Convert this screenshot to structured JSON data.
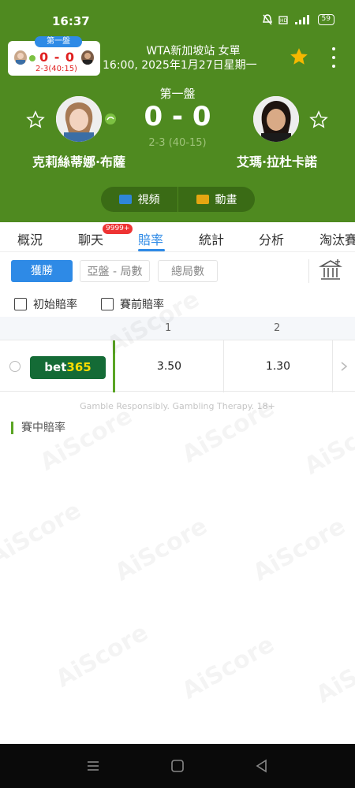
{
  "status_bar": {
    "time": "16:37",
    "battery": "59"
  },
  "mini_card": {
    "set_label": "第一盤",
    "score": "0 - 0",
    "sub": "2-3(40:15)"
  },
  "match": {
    "title": "WTA新加坡站 女單",
    "datetime": "16:00, 2025年1月27日星期一"
  },
  "score": {
    "set_label": "第一盤",
    "main": "0 - 0",
    "sub": "2-3 (40-15)"
  },
  "players": [
    {
      "name": "克莉絲蒂娜·布薩"
    },
    {
      "name": "艾瑪·拉杜卡諾"
    }
  ],
  "media": {
    "video": "視頻",
    "animation": "動畫"
  },
  "tabs": [
    {
      "label": "概況"
    },
    {
      "label": "聊天",
      "badge": "9999+"
    },
    {
      "label": "賠率"
    },
    {
      "label": "統計"
    },
    {
      "label": "分析"
    },
    {
      "label": "淘汰賽"
    }
  ],
  "filters": {
    "win": "獲勝",
    "handicap": "亞盤 - 局數",
    "total": "總局數"
  },
  "checkboxes": {
    "initial": "初始賠率",
    "pre_match": "賽前賠率"
  },
  "odds": {
    "columns": [
      "1",
      "2"
    ],
    "rows": [
      {
        "bookmaker": {
          "part1": "bet",
          "part2": "365"
        },
        "values": [
          "3.50",
          "1.30"
        ]
      }
    ]
  },
  "disclaimer": "Gamble Responsibly. Gambling Therapy. 18+",
  "section_inplay": "賽中賠率",
  "watermark": "AiScore",
  "colors": {
    "header_green": "#4f8a20",
    "accent_blue": "#2e8ae6",
    "bet365_green": "#146b36",
    "bet365_yellow": "#ffdd00",
    "live_red": "#e02020"
  }
}
